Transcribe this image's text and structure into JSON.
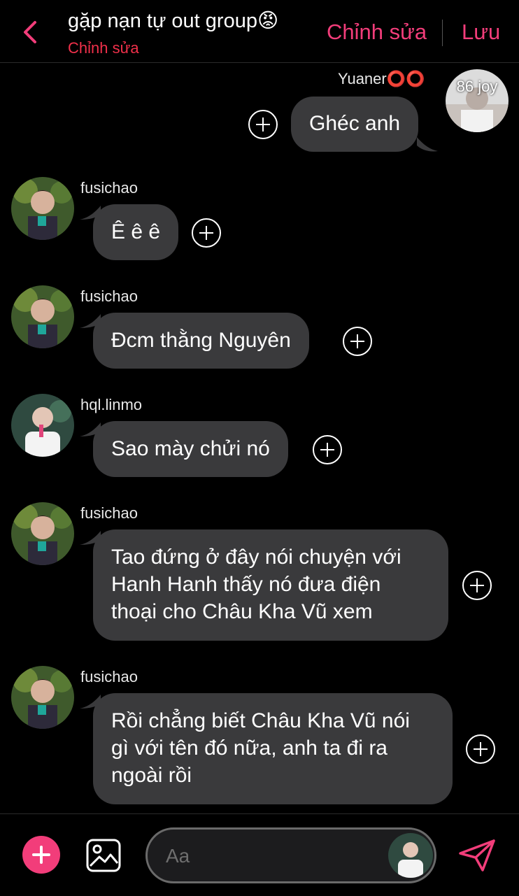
{
  "header": {
    "title": "gặp nạn tự out group",
    "title_emoji": "😡",
    "subtitle": "Chỉnh sửa",
    "edit_label": "Chỉnh sửa",
    "save_label": "Lưu"
  },
  "messages": [
    {
      "sender": "Yuaner⭕⭕",
      "text": "Ghéc anh",
      "avatar_label": "86 joy",
      "outgoing": true
    },
    {
      "sender": "fusichao",
      "text": "Ê ê ê",
      "outgoing": false
    },
    {
      "sender": "fusichao",
      "text": "Đcm thằng Nguyên",
      "outgoing": false
    },
    {
      "sender": "hql.linmo",
      "text": "Sao mày chửi nó",
      "outgoing": false
    },
    {
      "sender": "fusichao",
      "lines": [
        "Tao đứng ở đây nói chuyện với",
        "Hanh Hanh thấy nó đưa điện",
        "thoại cho Châu Kha Vũ xem"
      ],
      "outgoing": false
    },
    {
      "sender": "fusichao",
      "lines": [
        "Rồi chẳng biết Châu Kha Vũ nói",
        "gì với tên đó nữa, anh ta đi ra",
        "ngoài rồi"
      ],
      "outgoing": false
    }
  ],
  "composer": {
    "placeholder": "Aa"
  },
  "colors": {
    "accent": "#f23d7a",
    "subtitle": "#f0304a",
    "bubble": "#3a3a3c",
    "background": "#000000"
  },
  "icons": {
    "back": "chevron-left-icon",
    "add_reaction": "plus-circle-icon",
    "attach": "plus-icon",
    "gallery": "image-icon",
    "send": "send-icon"
  }
}
